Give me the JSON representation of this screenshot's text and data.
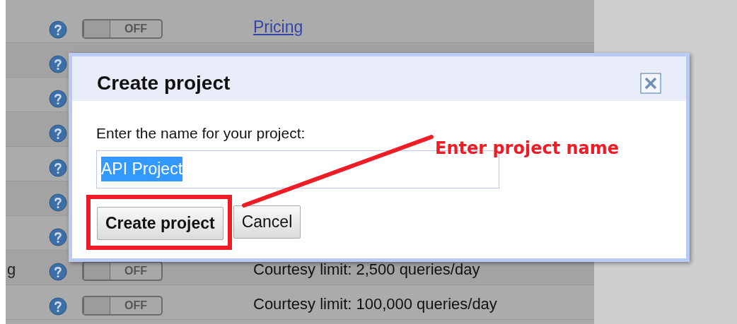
{
  "table": {
    "rows": [
      {
        "toggle": {
          "label": "OFF",
          "on": false
        },
        "link": "Pricing"
      },
      {},
      {},
      {},
      {},
      {},
      {},
      {
        "name": "g",
        "toggle": {
          "label": "OFF",
          "on": false
        },
        "text": "Courtesy limit: 2,500 queries/day"
      },
      {
        "toggle": {
          "label": "OFF",
          "on": false
        },
        "text": "Courtesy limit: 100,000 queries/day"
      }
    ]
  },
  "dialog": {
    "title": "Create project",
    "label": "Enter the name for your project:",
    "input": {
      "value": "API Project",
      "selected": true
    },
    "buttons": [
      {
        "label": "Create project",
        "kind": "primary"
      },
      {
        "label": "Cancel",
        "kind": "secondary"
      }
    ]
  },
  "annotation": {
    "text": "Enter project name",
    "color": "#ee1c25"
  }
}
